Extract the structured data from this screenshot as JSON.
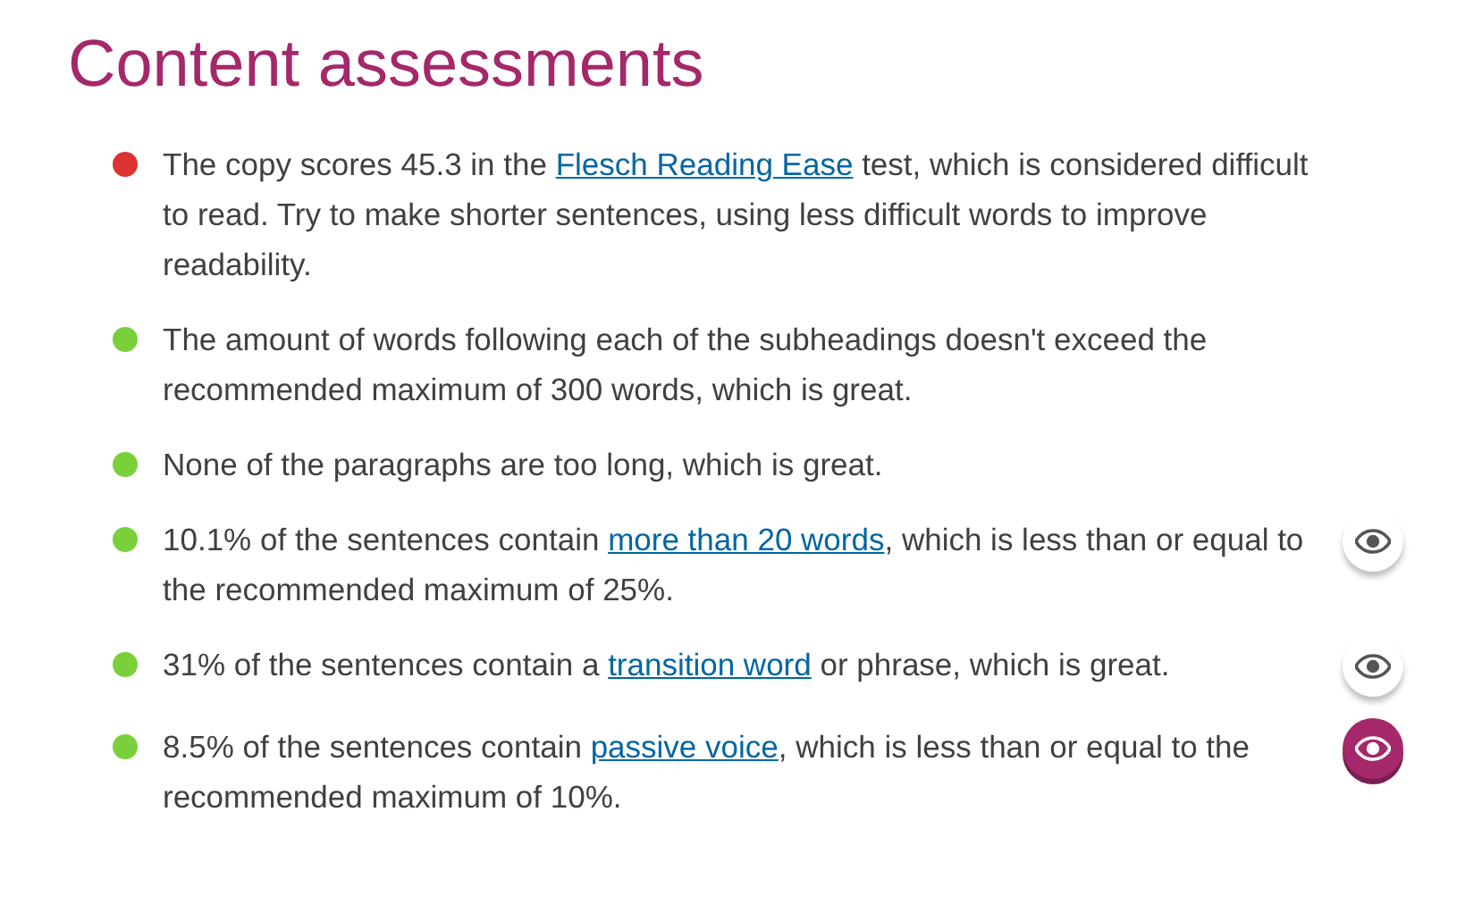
{
  "title": "Content assessments",
  "items": [
    {
      "color": "#dc3232",
      "before": "The copy scores 45.3 in the ",
      "link": "Flesch Reading Ease",
      "after": " test, which is considered difficult to read. Try to make shorter sentences, using less difficult words to improve readability."
    },
    {
      "color": "#7ad03a",
      "before": "The amount of words following each of the subheadings doesn't exceed the recommended maximum of 300 words, which is great."
    },
    {
      "color": "#7ad03a",
      "before": "None of the paragraphs are too long, which is great."
    },
    {
      "color": "#7ad03a",
      "before": "10.1% of the sentences contain ",
      "link": "more than 20 words",
      "after": ", which is less than or equal to the recommended maximum of 25%.",
      "marker": {
        "selected": false
      }
    },
    {
      "color": "#7ad03a",
      "before": "31% of the sentences contain a ",
      "link": "transition word",
      "after": " or phrase, which is great.",
      "marker": {
        "selected": false
      }
    },
    {
      "color": "#7ad03a",
      "before": "8.5% of the sentences contain ",
      "link": "passive voice",
      "after": ", which is less than or equal to the recommended maximum of 10%.",
      "marker": {
        "selected": true
      }
    }
  ]
}
